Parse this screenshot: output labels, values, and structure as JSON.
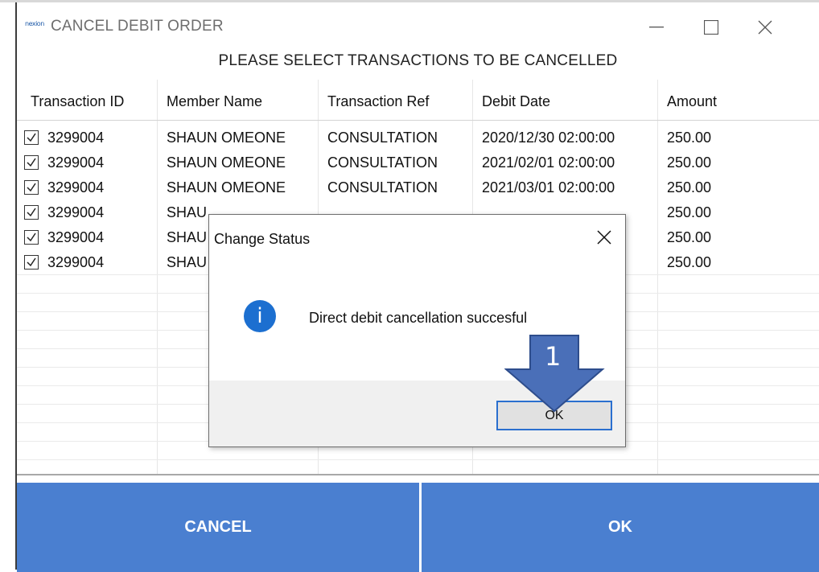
{
  "window": {
    "title": "CANCEL DEBIT ORDER",
    "header": "PLEASE SELECT TRANSACTIONS TO BE CANCELLED",
    "app_icon_text": "nexion"
  },
  "table": {
    "columns": [
      "Transaction ID",
      "Member Name",
      "Transaction Ref",
      "Debit Date",
      "Amount"
    ],
    "rows": [
      {
        "id": "3299004",
        "member": "SHAUN OMEONE",
        "ref": "CONSULTATION",
        "date": "2020/12/30 02:00:00",
        "amount": "250.00",
        "checked": true
      },
      {
        "id": "3299004",
        "member": "SHAUN OMEONE",
        "ref": "CONSULTATION",
        "date": "2021/02/01 02:00:00",
        "amount": "250.00",
        "checked": true
      },
      {
        "id": "3299004",
        "member": "SHAUN OMEONE",
        "ref": "CONSULTATION",
        "date": "2021/03/01 02:00:00",
        "amount": "250.00",
        "checked": true
      },
      {
        "id": "3299004",
        "member": "SHAU",
        "ref": "",
        "date": "",
        "amount": "250.00",
        "checked": true
      },
      {
        "id": "3299004",
        "member": "SHAU",
        "ref": "",
        "date": "",
        "amount": "250.00",
        "checked": true
      },
      {
        "id": "3299004",
        "member": "SHAU",
        "ref": "",
        "date": "",
        "amount": "250.00",
        "checked": true
      }
    ]
  },
  "buttons": {
    "cancel": "CANCEL",
    "ok": "OK"
  },
  "dialog": {
    "title": "Change Status",
    "message": "Direct debit cancellation succesful",
    "ok": "OK"
  },
  "annotation": {
    "step": "1"
  },
  "colors": {
    "primary_button": "#4a7fd0",
    "info_icon": "#1c6fd0",
    "annotation": "#4a6fb8"
  }
}
